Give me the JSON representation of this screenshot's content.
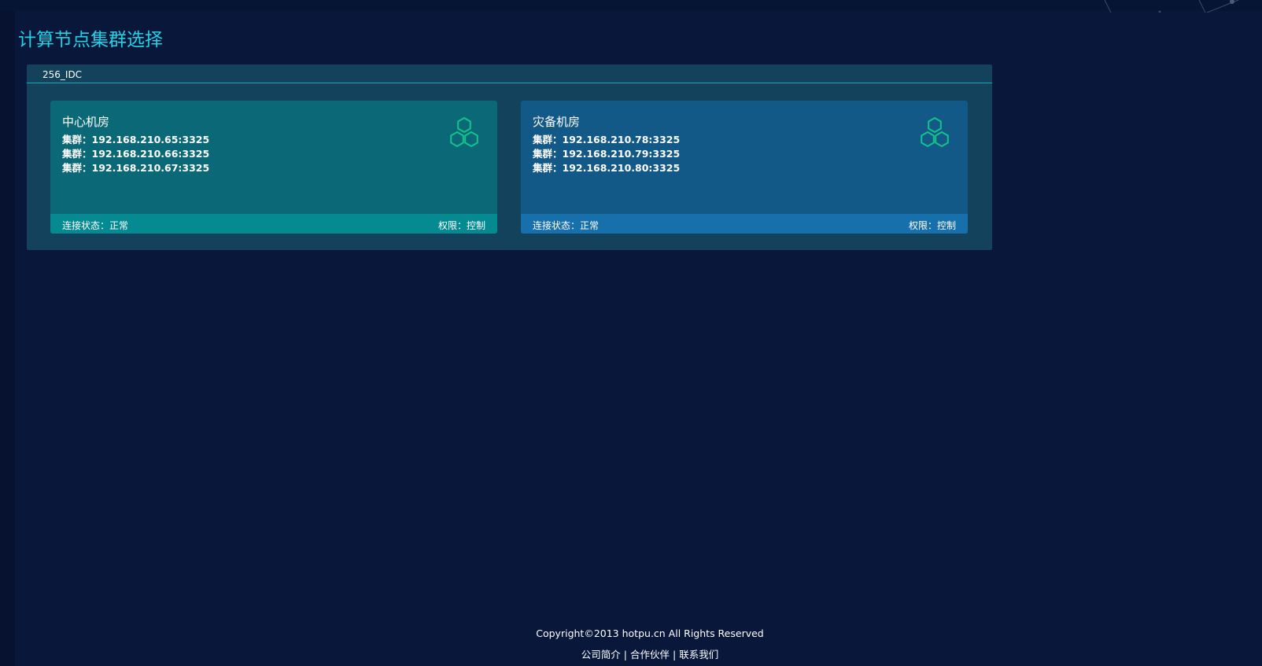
{
  "page": {
    "title": "计算节点集群选择"
  },
  "group": {
    "name": "256_IDC"
  },
  "cards": [
    {
      "title": "中心机房",
      "clusters": [
        "集群：192.168.210.65:3325",
        "集群：192.168.210.66:3325",
        "集群：192.168.210.67:3325"
      ],
      "status": "连接状态：正常",
      "permission": "权限：控制",
      "icon": "hexagon-cluster-icon",
      "color": "#0b6977",
      "footer_color": "#058a91"
    },
    {
      "title": "灾备机房",
      "clusters": [
        "集群：192.168.210.78:3325",
        "集群：192.168.210.79:3325",
        "集群：192.168.210.80:3325"
      ],
      "status": "连接状态：正常",
      "permission": "权限：控制",
      "icon": "hexagon-cluster-icon",
      "color": "#135988",
      "footer_color": "#1770ab"
    }
  ],
  "footer": {
    "copyright": "Copyright©2013 hotpu.cn All Rights Reserved",
    "links": [
      "公司简介",
      "合作伙伴",
      "联系我们"
    ],
    "separator": "|"
  },
  "colors": {
    "background": "#08173a",
    "title": "#1fd3e6",
    "panel": "#13425d",
    "icon": "#14c38a"
  }
}
